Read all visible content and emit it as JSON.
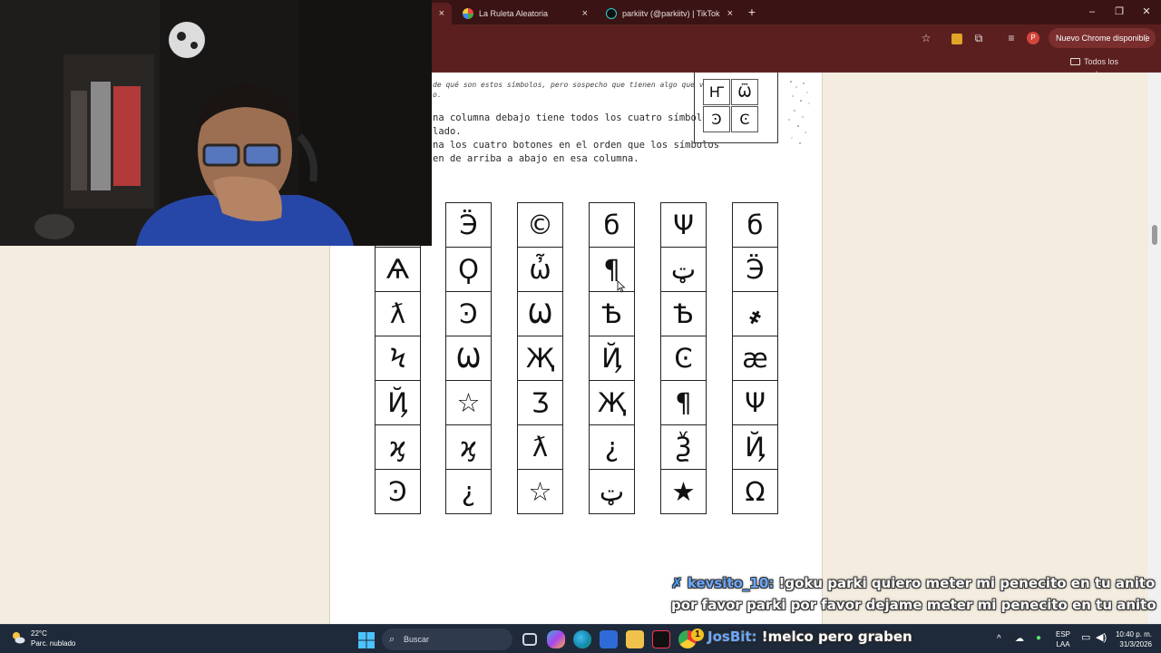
{
  "browser": {
    "tabs": [
      {
        "title": "",
        "active": true
      },
      {
        "title": "La Ruleta Aleatoria",
        "active": false
      },
      {
        "title": "parkiitv (@parkiitv) | TikTok",
        "active": false
      }
    ],
    "new_tab_glyph": "+",
    "close_glyph": "×",
    "window_controls": {
      "minimize": "–",
      "restore": "❐",
      "close": "✕"
    },
    "update_button": "Nuevo Chrome disponible",
    "profile_initial": "P",
    "bookmarks_folder": "Todos los marcadores"
  },
  "page": {
    "note_lines": [
      "de qué son estos símbolos, pero sospecho que tienen algo que ver",
      "o."
    ],
    "instructions": [
      "na columna debajo tiene todos los cuatro símbolos",
      "lado.",
      "na los cuatro botones en el orden que los símbolos",
      "en de arriba a abajo en esa columna."
    ],
    "keypad": [
      "Ҥ",
      "Ѿ",
      "Ͽ",
      "Ͼ"
    ],
    "columns": [
      [
        "",
        "Ѧ",
        "ƛ",
        "Ϟ",
        "Ҋ",
        "ϗ",
        "Ͽ"
      ],
      [
        "Ӭ",
        "Ϙ",
        "Ͽ",
        "Ѡ",
        "☆",
        "ϗ",
        "¿"
      ],
      [
        "©",
        "ὦ",
        "Ѡ",
        "Җ",
        "Ӡ",
        "ƛ",
        "☆"
      ],
      [
        "б",
        "¶",
        "Ѣ",
        "Ҋ",
        "Җ",
        "¿",
        "ټ"
      ],
      [
        "Ψ",
        "ټ",
        "Ѣ",
        "Ͼ",
        "¶",
        "Ѯ",
        "★"
      ],
      [
        "б",
        "Ӭ",
        "҂",
        "æ",
        "Ψ",
        "Ҋ",
        "Ω"
      ]
    ]
  },
  "chat": [
    {
      "user": "kevsito_10:",
      "message": "!goku parki quiero meter mi penecito en tu anito"
    },
    {
      "user": "",
      "message": "por favor parki por favor dejame meter mi penecito en tu anito"
    },
    {
      "user": "JosBit:",
      "message": "!melco pero graben"
    }
  ],
  "taskbar": {
    "weather_temp": "22°C",
    "weather_desc": "Parc. nublado",
    "search_placeholder": "Buscar",
    "lang_top": "ESP",
    "lang_bottom": "LAA",
    "time": "10:40 p. m.",
    "date": "31/3/2026"
  }
}
